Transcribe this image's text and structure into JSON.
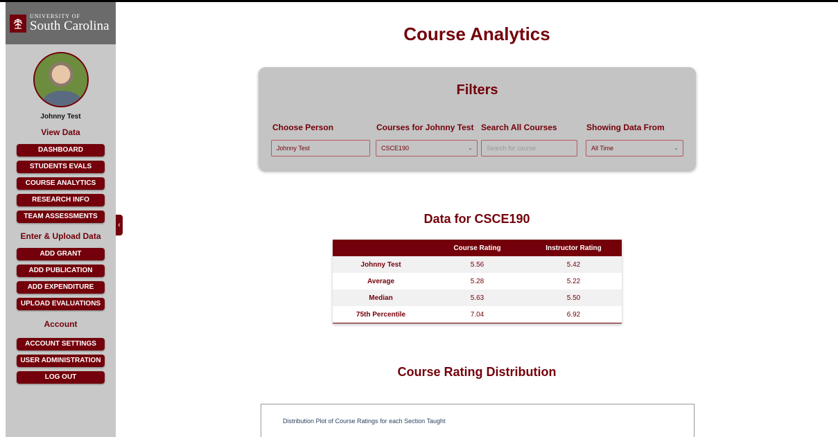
{
  "brand": {
    "small": "UNIVERSITY OF",
    "big": "South Carolina"
  },
  "user": {
    "name": "Johnny Test"
  },
  "sidebar": {
    "view_data_title": "View Data",
    "view_data": [
      "DASHBOARD",
      "STUDENTS EVALS",
      "COURSE ANALYTICS",
      "RESEARCH INFO",
      "TEAM ASSESSMENTS"
    ],
    "enter_title": "Enter & Upload Data",
    "enter": [
      "ADD GRANT",
      "ADD PUBLICATION",
      "ADD EXPENDITURE",
      "UPLOAD EVALUATIONS"
    ],
    "account_title": "Account",
    "account": [
      "ACCOUNT SETTINGS",
      "USER ADMINISTRATION",
      "LOG OUT"
    ]
  },
  "page": {
    "title": "Course Analytics"
  },
  "filters": {
    "title": "Filters",
    "person_label": "Choose Person",
    "person_value": "Johnny Test",
    "courses_label": "Courses for Johnny Test",
    "courses_value": "CSCE190",
    "search_label": "Search All Courses",
    "search_placeholder": "Search for course",
    "period_label": "Showing Data From",
    "period_value": "All Time"
  },
  "data_section": {
    "title": "Data for CSCE190",
    "headers": [
      "",
      "Course Rating",
      "Instructor Rating"
    ],
    "rows": [
      [
        "Johnny Test",
        "5.56",
        "5.42"
      ],
      [
        "Average",
        "5.28",
        "5.22"
      ],
      [
        "Median",
        "5.63",
        "5.50"
      ],
      [
        "75th Percentile",
        "7.04",
        "6.92"
      ]
    ]
  },
  "distribution": {
    "title": "Course Rating Distribution",
    "caption": "Distribution Plot of Course Ratings for each Section Taught"
  }
}
